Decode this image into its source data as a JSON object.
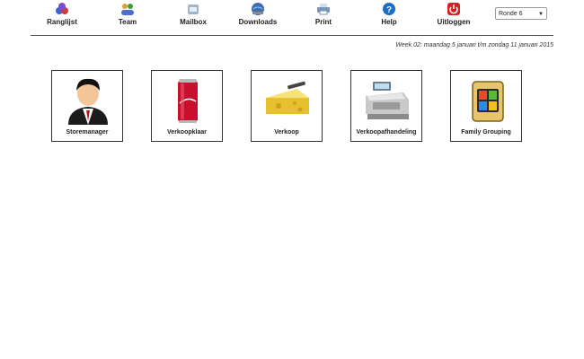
{
  "nav": [
    {
      "label": "Ranglijst",
      "icon": "ranking-icon"
    },
    {
      "label": "Team",
      "icon": "team-icon"
    },
    {
      "label": "Mailbox",
      "icon": "mailbox-icon"
    },
    {
      "label": "Downloads",
      "icon": "downloads-icon"
    },
    {
      "label": "Print",
      "icon": "print-icon"
    },
    {
      "label": "Help",
      "icon": "help-icon"
    },
    {
      "label": "Uitloggen",
      "icon": "logout-icon"
    }
  ],
  "round_select": {
    "value": "Ronde 6"
  },
  "week_text": "Week 02: maandag 5 januari t/m zondag 11 januari 2015",
  "tiles": [
    {
      "label": "Storemanager",
      "icon": "storemanager-icon"
    },
    {
      "label": "Verkoopklaar",
      "icon": "cola-can-icon"
    },
    {
      "label": "Verkoop",
      "icon": "cheese-icon"
    },
    {
      "label": "Verkoopafhandeling",
      "icon": "cash-register-icon"
    },
    {
      "label": "Family Grouping",
      "icon": "family-grouping-icon"
    }
  ],
  "colors": {
    "divider": "#555555",
    "help_blue": "#1a6fc2",
    "logout_red": "#d42020",
    "cola_red": "#c8102e"
  }
}
